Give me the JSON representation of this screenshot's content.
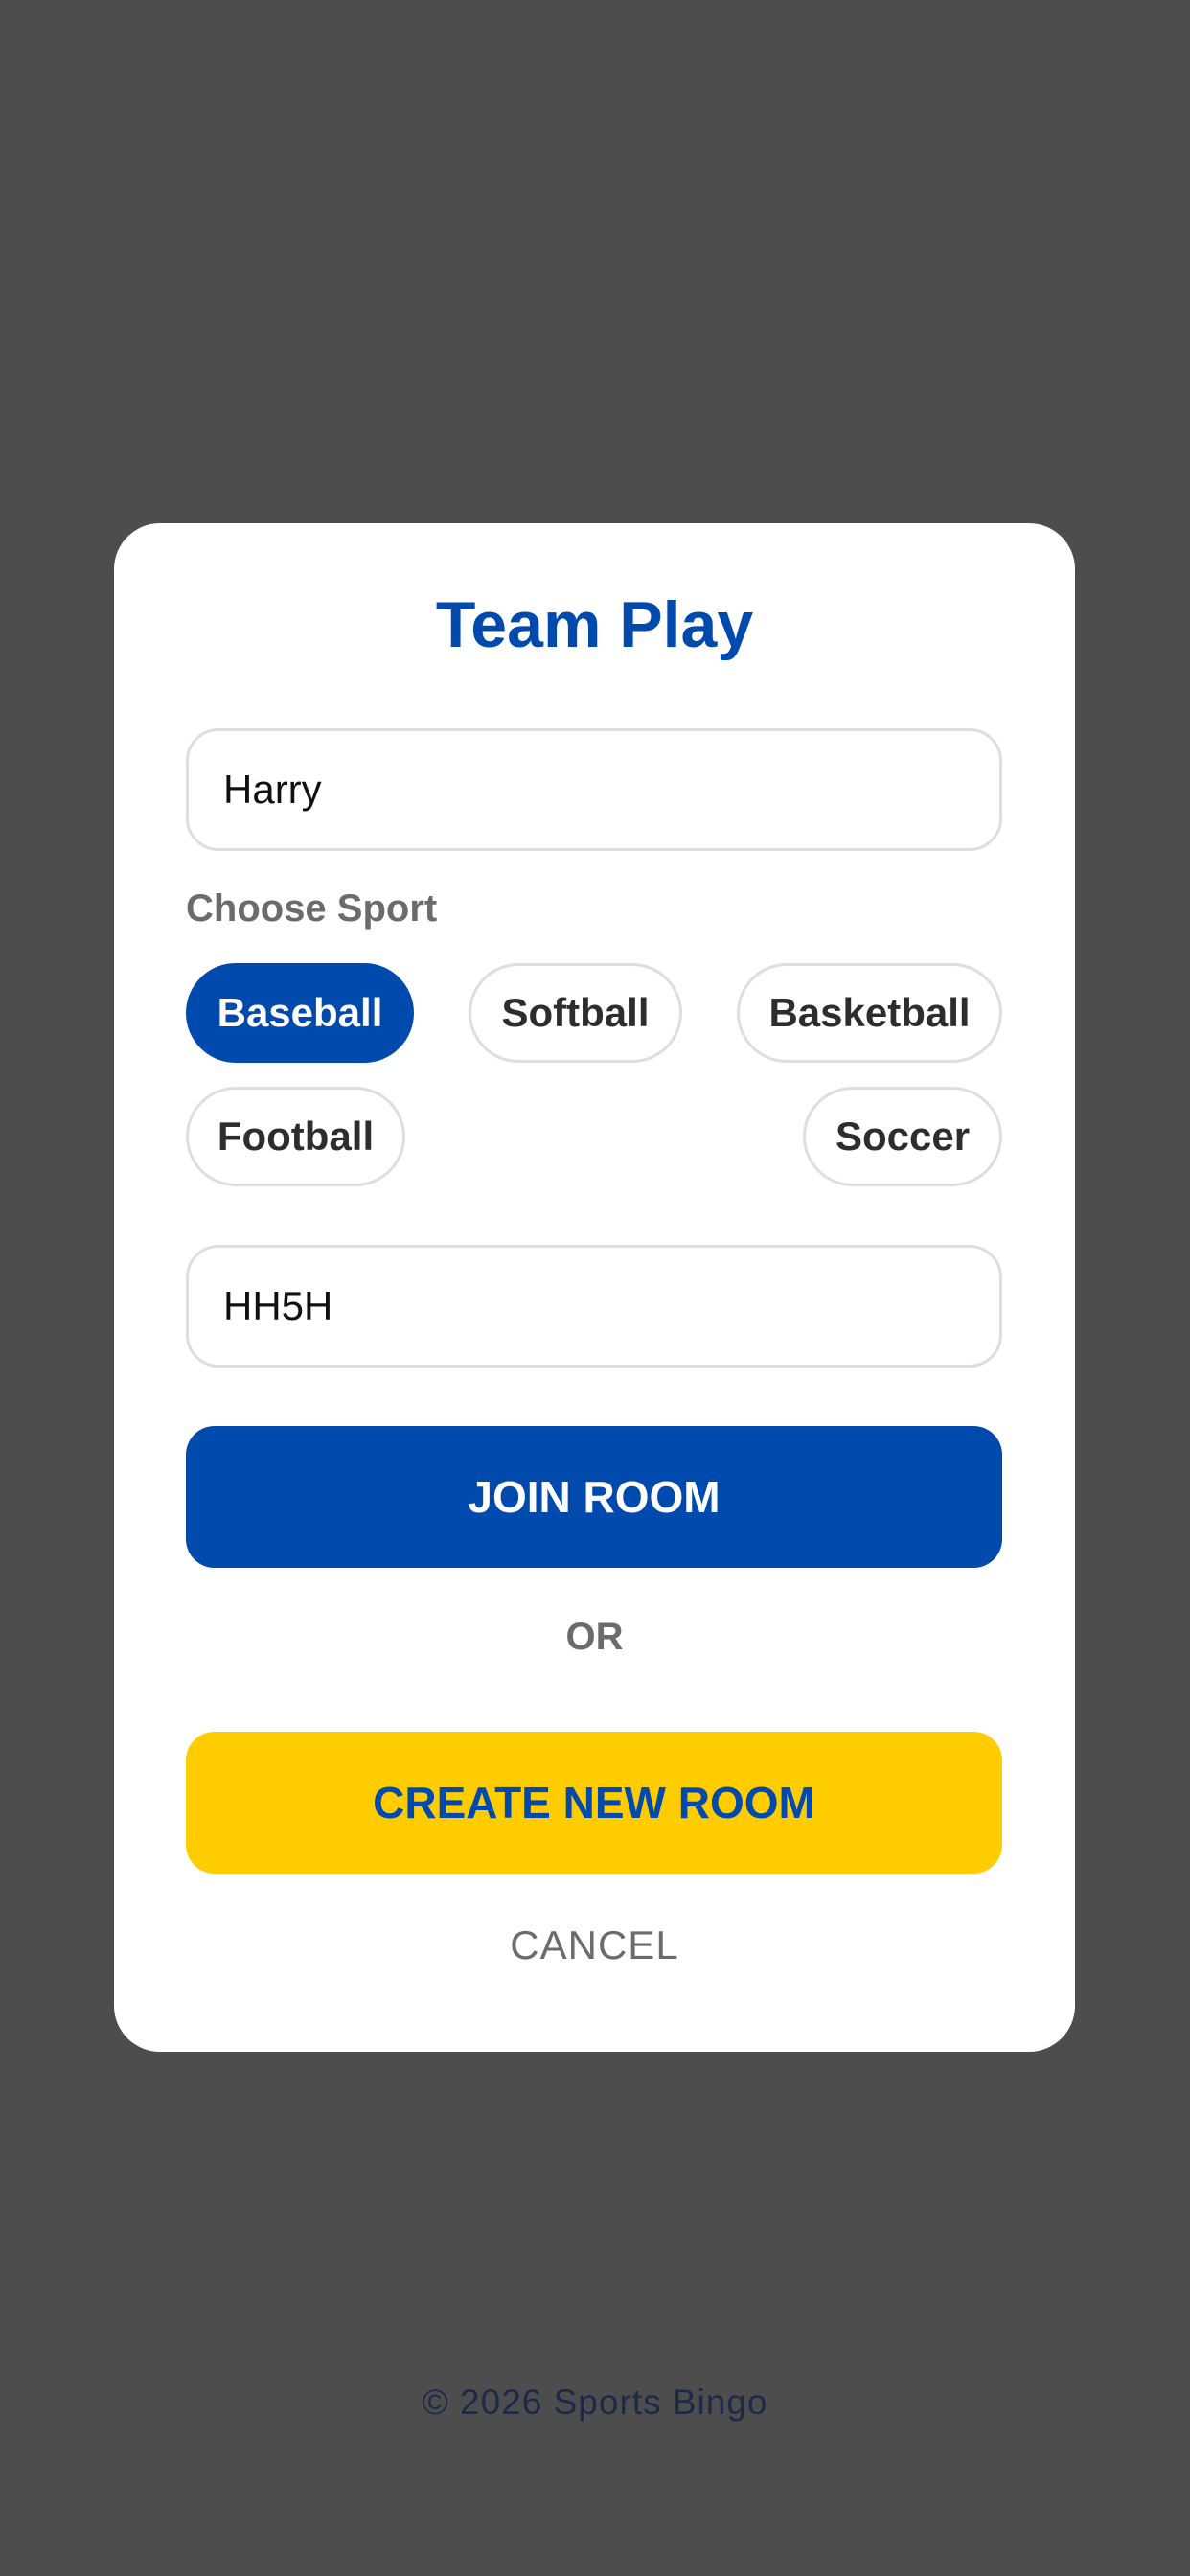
{
  "modal": {
    "title": "Team Play",
    "name_field": {
      "value": "Harry",
      "placeholder": ""
    },
    "sport_label": "Choose Sport",
    "sports": [
      {
        "label": "Baseball",
        "selected": true
      },
      {
        "label": "Softball",
        "selected": false
      },
      {
        "label": "Basketball",
        "selected": false
      },
      {
        "label": "Football",
        "selected": false
      },
      {
        "label": "Soccer",
        "selected": false
      }
    ],
    "room_code_field": {
      "value": "HH5H",
      "placeholder": ""
    },
    "join_button": "JOIN ROOM",
    "or_label": "OR",
    "create_button": "CREATE NEW ROOM",
    "cancel_button": "CANCEL"
  },
  "footer": {
    "copyright": "© 2026 Sports Bingo"
  },
  "colors": {
    "backdrop": "#4d4d4d",
    "primary": "#004aad",
    "accent": "#ffcc00",
    "muted_text": "#6b6b6b"
  }
}
